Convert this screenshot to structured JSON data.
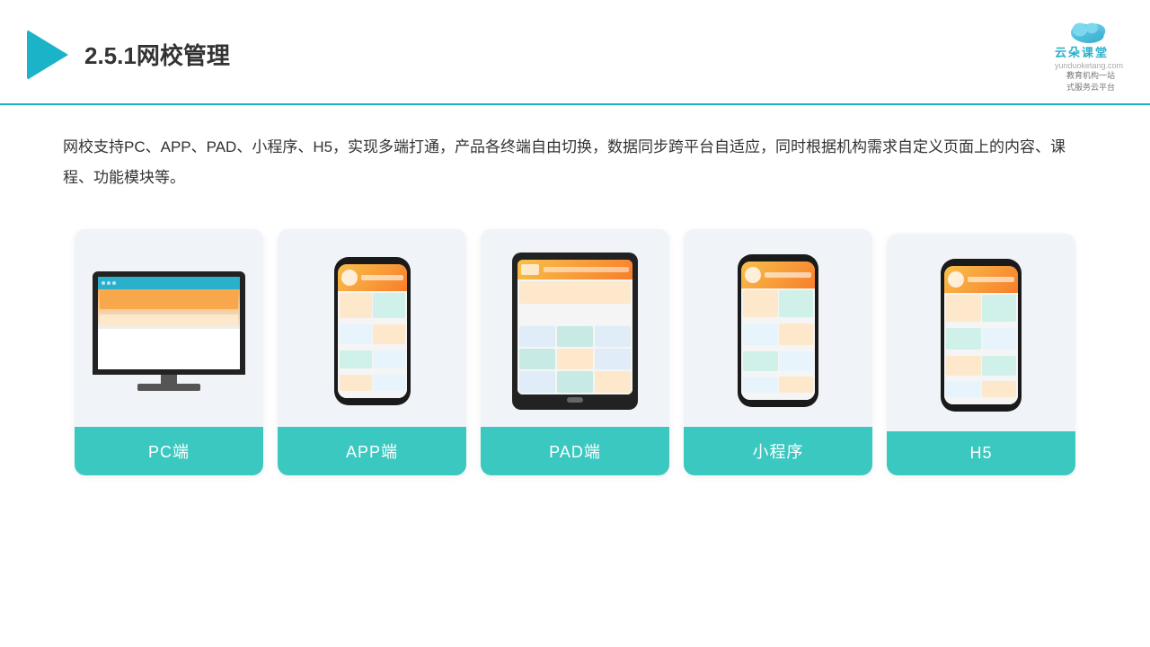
{
  "header": {
    "section_number": "2.5.1",
    "title": "网校管理",
    "brand_name": "云朵课堂",
    "brand_url": "yunduoketang.com",
    "brand_tagline_line1": "教育机构一站",
    "brand_tagline_line2": "式服务云平台"
  },
  "description": {
    "text": "网校支持PC、APP、PAD、小程序、H5，实现多端打通，产品各终端自由切换，数据同步跨平台自适应，同时根据机构需求自定义页面上的内容、课程、功能模块等。"
  },
  "cards": [
    {
      "id": "pc",
      "label": "PC端"
    },
    {
      "id": "app",
      "label": "APP端"
    },
    {
      "id": "pad",
      "label": "PAD端"
    },
    {
      "id": "miniapp",
      "label": "小程序"
    },
    {
      "id": "h5",
      "label": "H5"
    }
  ]
}
